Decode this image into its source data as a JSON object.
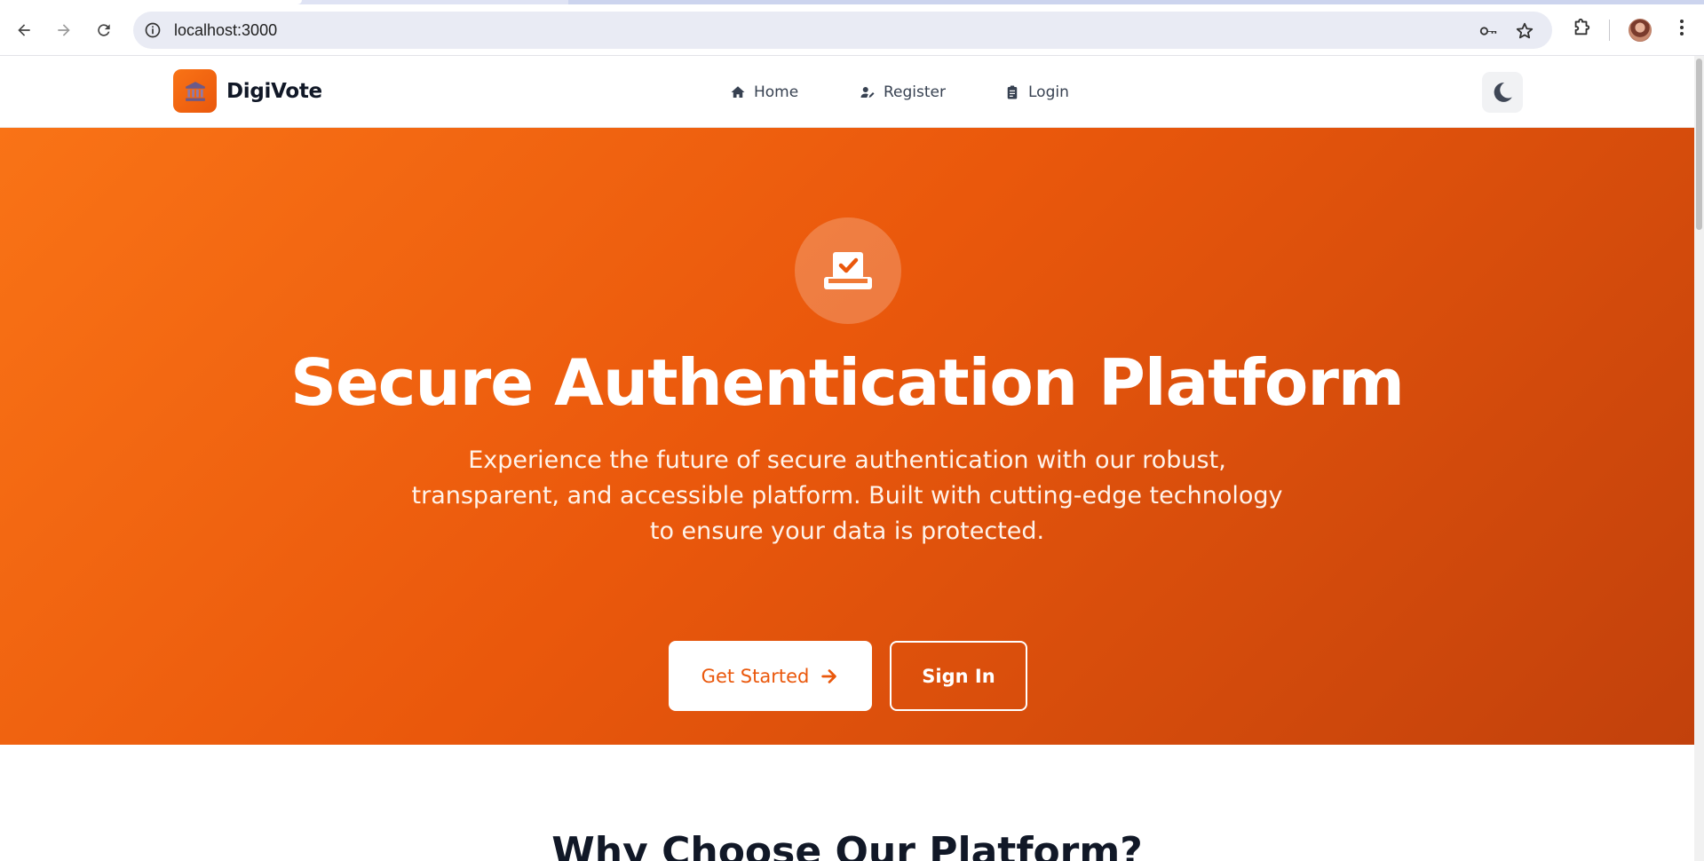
{
  "browser": {
    "url": "localhost:3000",
    "icons": [
      "back-icon",
      "forward-icon",
      "reload-icon",
      "info-icon",
      "key-icon",
      "star-icon",
      "extensions-icon",
      "avatar",
      "menu-kebab-icon"
    ]
  },
  "navbar": {
    "brand": "DigiVote",
    "logo_icon": "landmark-icon",
    "links": [
      {
        "label": "Home",
        "icon": "home-icon"
      },
      {
        "label": "Register",
        "icon": "user-edit-icon"
      },
      {
        "label": "Login",
        "icon": "clipboard-icon"
      }
    ],
    "theme_toggle_icon": "moon-icon"
  },
  "hero": {
    "icon": "vote-box-icon",
    "title": "Secure Authentication Platform",
    "subtitle_lines": [
      "Experience the future of secure authentication with our robust,",
      "transparent, and accessible platform. Built with cutting-edge technology",
      "to ensure your data is protected."
    ],
    "primary_button": "Get Started",
    "secondary_button": "Sign In"
  },
  "features": {
    "title": "Why Choose Our Platform?"
  },
  "colors": {
    "accent": "#ea580c",
    "accent_light": "#f97316",
    "accent_dark": "#c2410c",
    "text_dark": "#111827"
  }
}
